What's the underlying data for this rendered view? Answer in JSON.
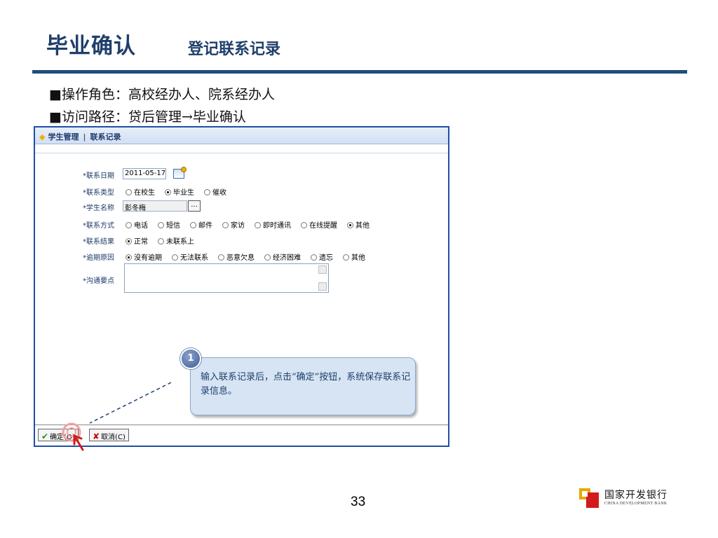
{
  "slide": {
    "title": "毕业确认",
    "subtitle": "登记联系记录",
    "bullets": [
      "■操作角色：高校经办人、院系经办人",
      "■访问路径：贷后管理→毕业确认"
    ],
    "page_number": "33"
  },
  "app": {
    "breadcrumb": {
      "section": "学生管理",
      "separator": "|",
      "page": "联系记录"
    },
    "form": {
      "contact_date": {
        "label": "*联系日期",
        "value": "2011-05-17"
      },
      "contact_type": {
        "label": "*联系类型",
        "options": [
          "在校生",
          "毕业生",
          "催收"
        ],
        "selected": "毕业生"
      },
      "student_name": {
        "label": "*学生名称",
        "value": "彭冬梅",
        "lookup_label": "..."
      },
      "contact_method": {
        "label": "*联系方式",
        "options": [
          "电话",
          "短信",
          "邮件",
          "家访",
          "即时通讯",
          "在线提醒",
          "其他"
        ],
        "selected": "其他"
      },
      "contact_result": {
        "label": "*联系结果",
        "options": [
          "正常",
          "未联系上"
        ],
        "selected": "正常"
      },
      "overdue_reason": {
        "label": "*逾期原因",
        "options": [
          "没有逾期",
          "无法联系",
          "恶意欠息",
          "经济困难",
          "遗忘",
          "其他"
        ],
        "selected": "没有逾期"
      },
      "notes": {
        "label": "*沟通要点",
        "value": ""
      }
    },
    "buttons": {
      "confirm": "确定(O)",
      "cancel": "取消(C)"
    }
  },
  "callout": {
    "step": "1",
    "text": "输入联系记录后，点击“确定”按钮，系统保存联系记录信息。"
  },
  "logo": {
    "cn": "国家开发银行",
    "en": "CHINA DEVELOPMENT BANK"
  }
}
